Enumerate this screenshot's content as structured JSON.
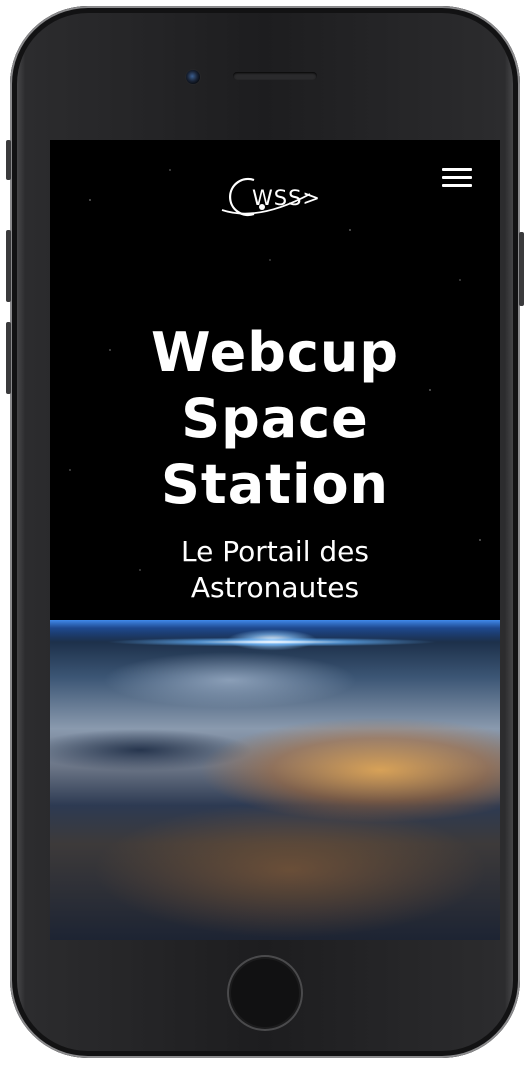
{
  "device": {
    "model": "phone",
    "colors": {
      "frame": "#1d1d1f",
      "screen": "#000000"
    }
  },
  "header": {
    "logo_text": "WSS>",
    "menu_icon": "hamburger-menu-icon"
  },
  "hero": {
    "title_lines": [
      "Webcup",
      "Space",
      "Station"
    ],
    "subtitle_lines": [
      "Le Portail des",
      "Astronautes"
    ]
  },
  "colors": {
    "text": "#ffffff",
    "background": "#000000"
  }
}
